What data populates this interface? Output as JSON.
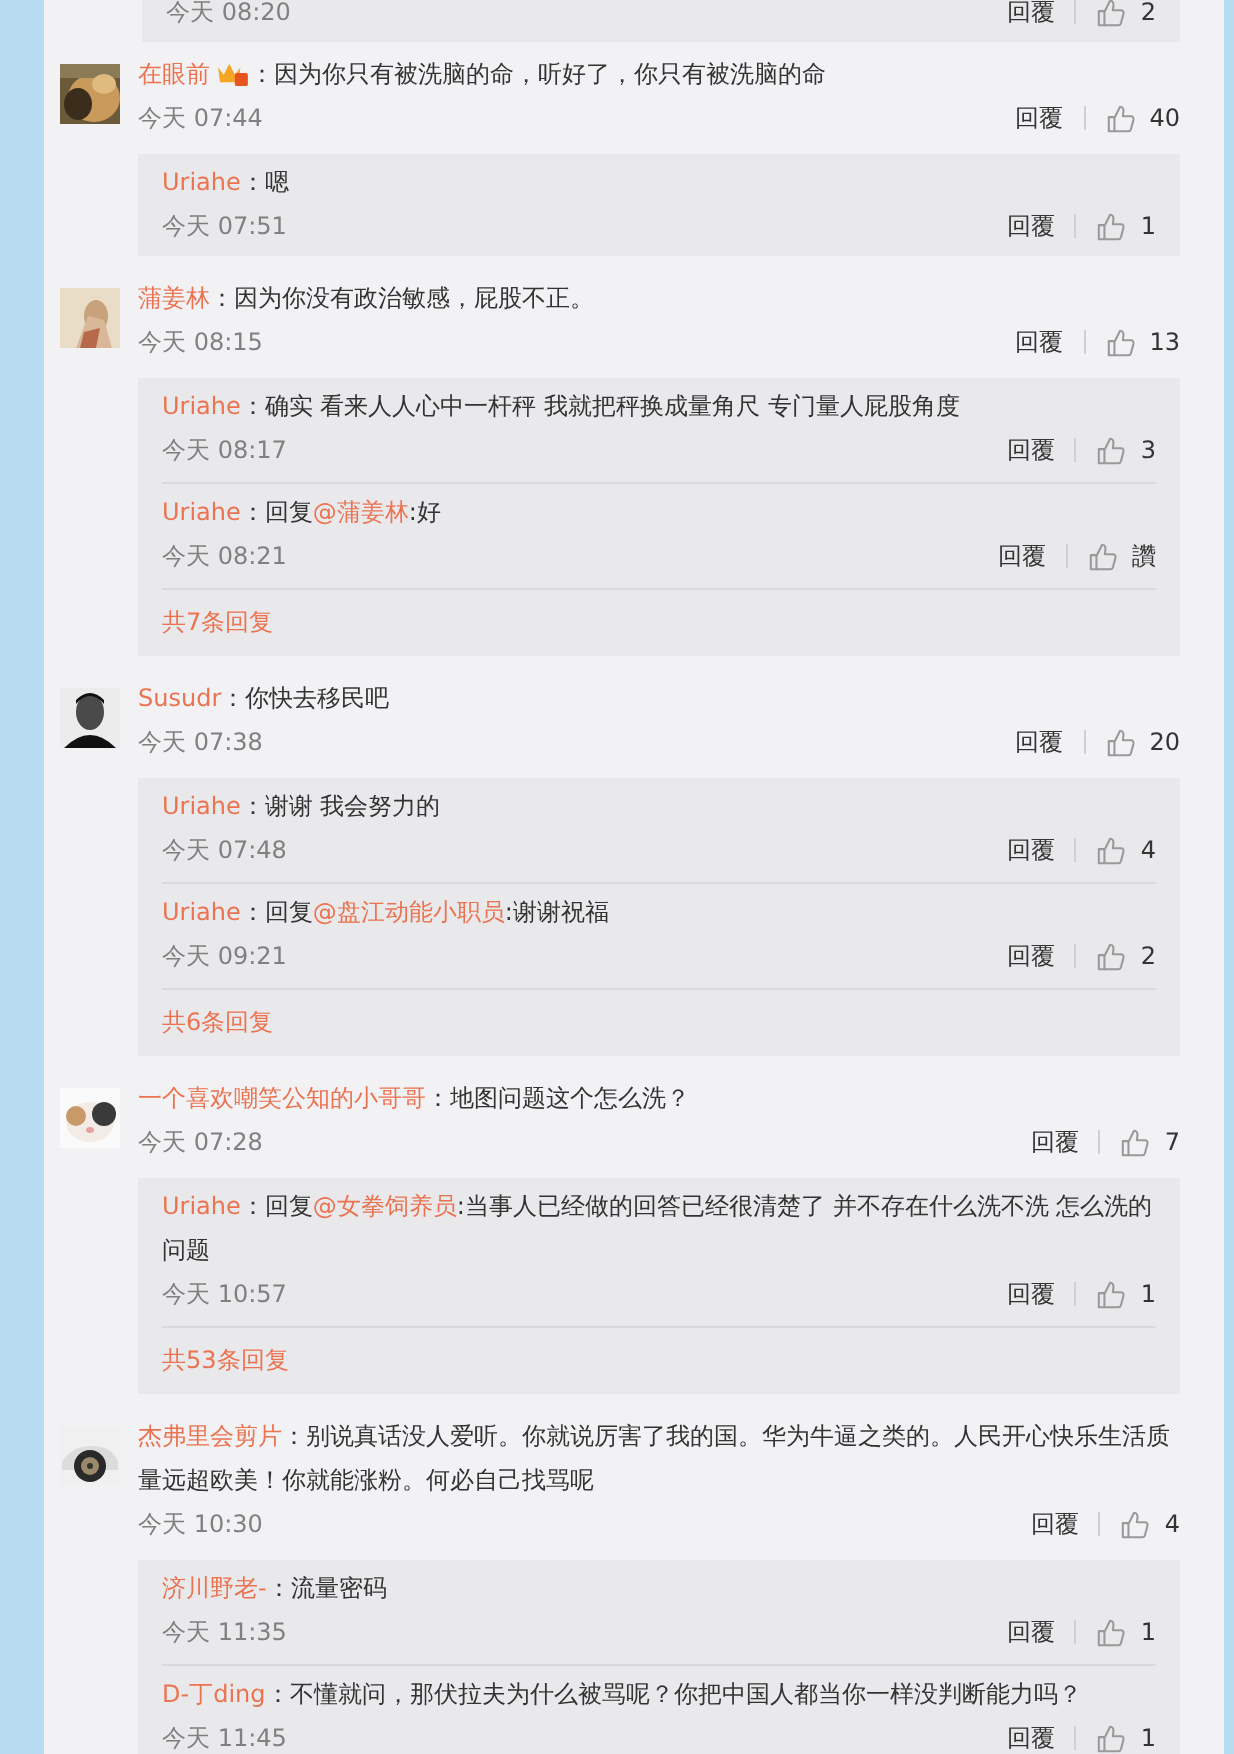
{
  "top_partial_reply": {
    "time": "今天 08:20",
    "reply_label": "回覆",
    "likes": "2"
  },
  "comments": [
    {
      "user": "在眼前",
      "vip_badge": true,
      "segments": [
        {
          "kind": "text",
          "text": "：因为你只有被洗脑的命，听好了，你只有被洗脑的命"
        }
      ],
      "time": "今天 07:44",
      "reply_label": "回覆",
      "likes": "40",
      "replies": [
        {
          "user": "Uriahe",
          "segments": [
            {
              "kind": "text",
              "text": "：嗯"
            }
          ],
          "time": "今天 07:51",
          "reply_label": "回覆",
          "likes": "1"
        }
      ]
    },
    {
      "user": "蒲姜林",
      "vip_badge": false,
      "segments": [
        {
          "kind": "text",
          "text": "：因为你没有政治敏感，屁股不正。"
        }
      ],
      "time": "今天 08:15",
      "reply_label": "回覆",
      "likes": "13",
      "replies": [
        {
          "user": "Uriahe",
          "segments": [
            {
              "kind": "text",
              "text": "：确实 看来人人心中一杆秤 我就把秤换成量角尺  专门量人屁股角度"
            }
          ],
          "time": "今天 08:17",
          "reply_label": "回覆",
          "likes": "3"
        },
        {
          "user": "Uriahe",
          "segments": [
            {
              "kind": "text",
              "text": "：回复"
            },
            {
              "kind": "mention",
              "text": "@蒲姜林"
            },
            {
              "kind": "text",
              "text": ":好"
            }
          ],
          "time": "今天 08:21",
          "reply_label": "回覆",
          "likes": "讚"
        }
      ],
      "more": "共7条回复"
    },
    {
      "user": "Susudr",
      "vip_badge": false,
      "segments": [
        {
          "kind": "text",
          "text": "：你快去移民吧"
        }
      ],
      "time": "今天 07:38",
      "reply_label": "回覆",
      "likes": "20",
      "replies": [
        {
          "user": "Uriahe",
          "segments": [
            {
              "kind": "text",
              "text": "：谢谢 我会努力的"
            }
          ],
          "time": "今天 07:48",
          "reply_label": "回覆",
          "likes": "4"
        },
        {
          "user": "Uriahe",
          "segments": [
            {
              "kind": "text",
              "text": "：回复"
            },
            {
              "kind": "mention",
              "text": "@盘江动能小职员"
            },
            {
              "kind": "text",
              "text": ":谢谢祝福"
            }
          ],
          "time": "今天 09:21",
          "reply_label": "回覆",
          "likes": "2"
        }
      ],
      "more": "共6条回复"
    },
    {
      "user": "一个喜欢嘲笑公知的小哥哥",
      "vip_badge": false,
      "segments": [
        {
          "kind": "text",
          "text": "：地图问题这个怎么洗？"
        }
      ],
      "time": "今天 07:28",
      "reply_label": "回覆",
      "likes": "7",
      "replies": [
        {
          "user": "Uriahe",
          "segments": [
            {
              "kind": "text",
              "text": "：回复"
            },
            {
              "kind": "mention",
              "text": "@女拳饲养员"
            },
            {
              "kind": "text",
              "text": ":当事人已经做的回答已经很清楚了 并不存在什么洗不洗 怎么洗的问题"
            }
          ],
          "time": "今天 10:57",
          "reply_label": "回覆",
          "likes": "1"
        }
      ],
      "more": "共53条回复"
    },
    {
      "user": "杰弗里会剪片",
      "vip_badge": false,
      "segments": [
        {
          "kind": "text",
          "text": "：别说真话没人爱听。你就说厉害了我的国。华为牛逼之类的。人民开心快乐生活质量远超欧美！你就能涨粉。何必自己找骂呢"
        }
      ],
      "time": "今天 10:30",
      "reply_label": "回覆",
      "likes": "4",
      "replies": [
        {
          "user": "济川野老-",
          "segments": [
            {
              "kind": "text",
              "text": "：流量密码"
            }
          ],
          "time": "今天 11:35",
          "reply_label": "回覆",
          "likes": "1"
        },
        {
          "user": "D-丁ding",
          "segments": [
            {
              "kind": "text",
              "text": "：不懂就问，那伏拉夫为什么被骂呢？你把中国人都当你一样没判断能力吗？"
            }
          ],
          "time": "今天 11:45",
          "reply_label": "回覆",
          "likes": "1"
        }
      ]
    }
  ]
}
